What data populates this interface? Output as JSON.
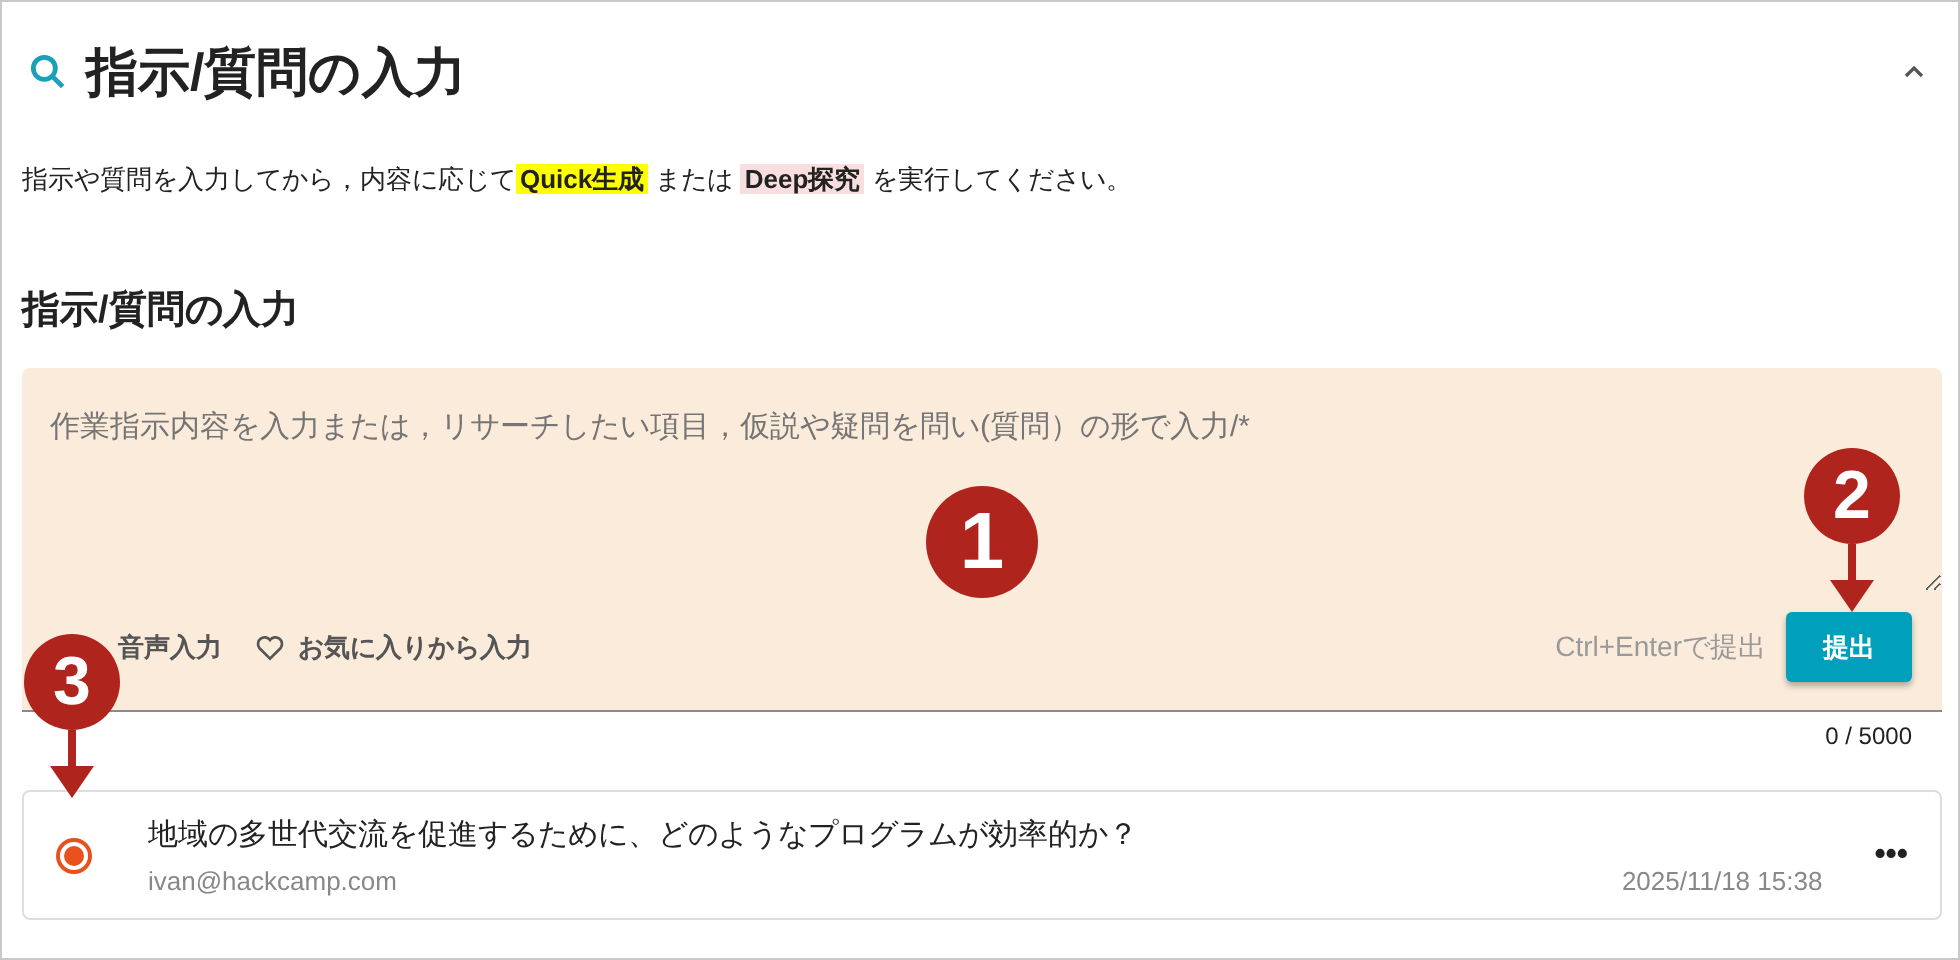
{
  "header": {
    "title": "指示/質問の入力",
    "expanded": true
  },
  "description": [
    {
      "text": "指示や質問を入力してから，内容に応じて"
    },
    {
      "text": "Quick生成",
      "color": "#ffff00"
    },
    {
      "text": " または "
    },
    {
      "text": "Deep探究",
      "color": "#f8dede"
    },
    {
      "text": " を実行してください。"
    }
  ],
  "section_title": "指示/質問の入力",
  "input": {
    "placeholder": "作業指示内容を入力または，リサーチしたい項目，仮説や疑問を問い(質問）の形で入力/*",
    "actions": [
      {
        "label": "音声入力",
        "kind": "voice"
      },
      {
        "label": "お気に入りから入力",
        "kind": "favorite"
      }
    ],
    "hint": "Ctrl+Enterで提出",
    "submit": "提出",
    "counter": "0 / 5000"
  },
  "history": [
    {
      "question": "地域の多世代交流を促進するために、どのようなプログラムが効率的か？",
      "author": "ivan@hackcamp.com",
      "date": "2025/11/18 15:38",
      "selected": true,
      "menu": "•••"
    }
  ],
  "callouts": [
    {
      "number": "1",
      "arrow": false
    },
    {
      "number": "2",
      "arrow": true
    },
    {
      "number": "3",
      "arrow": true
    }
  ]
}
